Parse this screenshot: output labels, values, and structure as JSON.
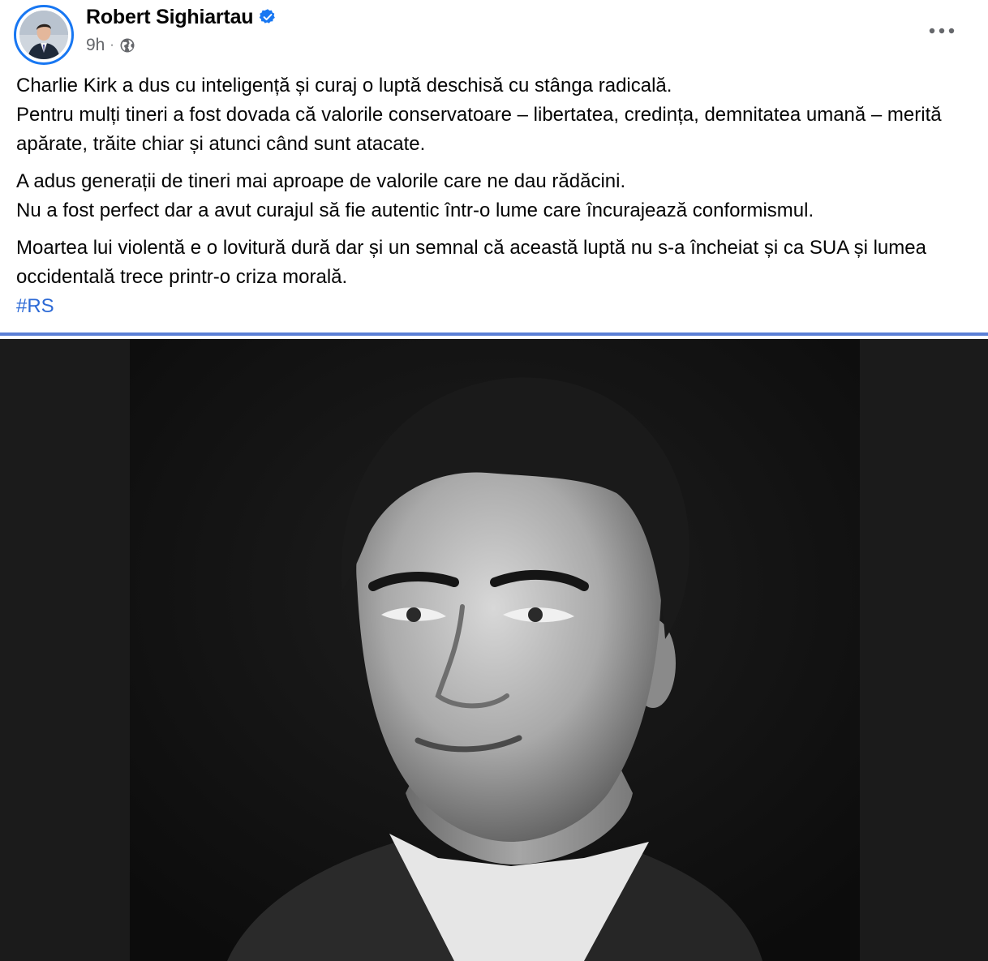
{
  "post": {
    "author_name": "Robert Sighiartau",
    "timestamp": "9h",
    "separator": "·",
    "paragraphs": [
      {
        "lines": [
          "Charlie Kirk a dus cu inteligență și curaj o luptă deschisă cu stânga radicală.",
          "Pentru mulți tineri a fost dovada că valorile conservatoare – libertatea, credința, demnitatea umană – merită apărate, trăite chiar și atunci când sunt atacate."
        ]
      },
      {
        "lines": [
          "A adus generații de tineri mai aproape de valorile care ne dau rădăcini.",
          "Nu a fost perfect dar a avut curajul să fie autentic într-o lume care încurajează conformismul."
        ]
      },
      {
        "lines": [
          "Moartea lui violentă e o lovitură dură dar și un semnal că această luptă nu s-a încheiat și ca SUA și lumea occidentală trece printr-o criza morală."
        ]
      }
    ],
    "hashtag": "#RS"
  },
  "icons": {
    "verified": "verified-badge-icon",
    "privacy": "globe-icon",
    "more": "more-options-icon"
  },
  "colors": {
    "verified_blue": "#1877f2",
    "hashtag_blue": "#2d6ad6",
    "meta_gray": "#65676b",
    "divider_blue": "#5b7fd6"
  }
}
